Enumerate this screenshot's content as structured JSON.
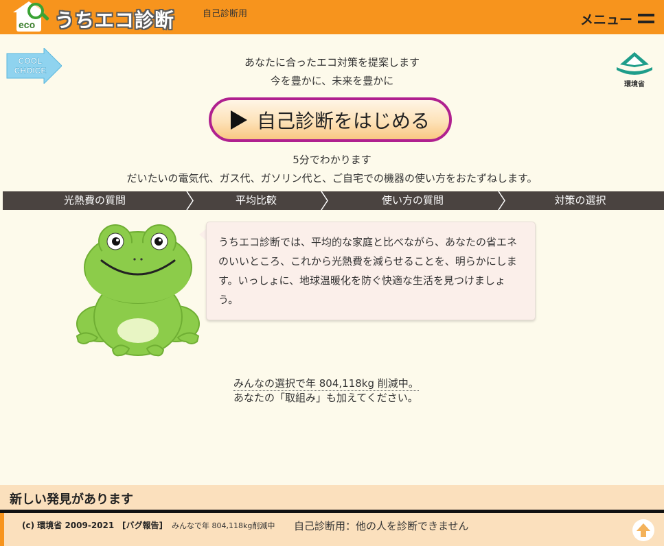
{
  "header": {
    "logo_eco": "eco",
    "logo_title": "うちエコ診断",
    "subtitle": "自己診断用",
    "menu_label": "メニュー",
    "background_color": "#f7941d"
  },
  "badges": {
    "cool_choice_line1": "COOL",
    "cool_choice_line2": "CHOICE",
    "ministry_label": "環境省"
  },
  "intro": {
    "line1": "あなたに合ったエコ対策を提案します",
    "line2": "今を豊かに、未来を豊かに"
  },
  "start_button": {
    "label": "自己診断をはじめる",
    "icon": "play-icon",
    "border_color": "#b0208f"
  },
  "notes": {
    "duration": "5分でわかります",
    "description": "だいたいの電気代、ガス代、ガソリン代と、ご自宅での機器の使い方をおたずねします。"
  },
  "steps": [
    {
      "label": "光熱費の質問"
    },
    {
      "label": "平均比較"
    },
    {
      "label": "使い方の質問"
    },
    {
      "label": "対策の選択"
    }
  ],
  "bubble": {
    "text": "うちエコ診断では、平均的な家庭と比べながら、あなたの省エネのいいところ、これから光熱費を減らせることを、明らかにします。いっしょに、地球温暖化を防ぐ快適な生活を見つけましょう。"
  },
  "stats": {
    "line1": "みんなの選択で年 804,118kg 削減中。",
    "line2": "あなたの「取組み」も加えてください。"
  },
  "discover": {
    "title": "新しい発見があります"
  },
  "footer": {
    "copyright": "(c) 環境省 2009-2021",
    "bug_report": "[バグ報告]",
    "stat": "みんなで年 804,118kg削減中",
    "message": "自己診断用：他の人を診断できません",
    "top_icon": "arrow-up-icon"
  }
}
